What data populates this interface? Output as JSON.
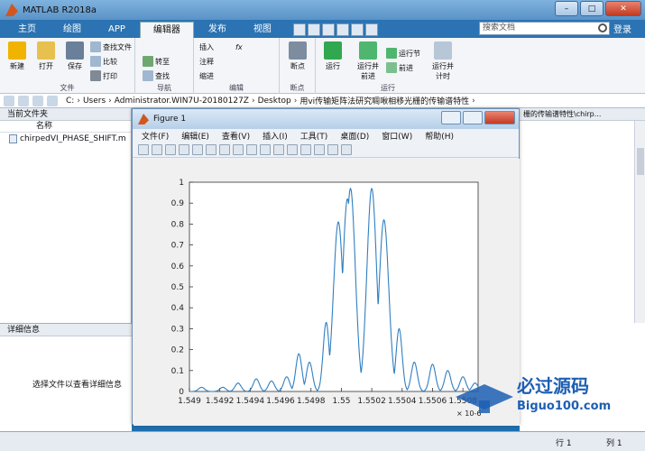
{
  "window": {
    "title": "MATLAB R2018a"
  },
  "tabs": [
    {
      "label": "主页"
    },
    {
      "label": "绘图"
    },
    {
      "label": "APP"
    },
    {
      "label": "编辑器"
    },
    {
      "label": "发布"
    },
    {
      "label": "视图"
    }
  ],
  "search": {
    "placeholder": "搜索文档"
  },
  "login": "登录",
  "ribbon": {
    "new": "新建",
    "open": "打开",
    "save": "保存",
    "find_files": "查找文件",
    "compare": "比较",
    "print": "打印",
    "group_file": "文件",
    "goto": "转至",
    "find": "查找",
    "group_nav": "导航",
    "insert": "插入",
    "comment": "注释",
    "indent": "缩进",
    "fx": "fx",
    "group_edit": "编辑",
    "breakpoints": "断点",
    "group_bp": "断点",
    "run": "运行",
    "run_adv": "运行并\n前进",
    "run_section": "运行节",
    "advance": "前进",
    "run_time": "运行并\n计时",
    "group_run": "运行"
  },
  "path": [
    "C:",
    "Users",
    "Administrator.WIN7U-20180127Z",
    "Desktop",
    "用vi传输矩阵法研究啁啾相移光栅的传输谱特性"
  ],
  "leftpanel": {
    "header": "当前文件夹",
    "column": "名称",
    "file": "chirpedVI_PHASE_SHIFT.m"
  },
  "details": {
    "header": "详细信息",
    "hint": "选择文件以查看详细信息"
  },
  "rightpath": "栅的传输谱特性\\chirp...",
  "status": {
    "row_label": "行",
    "row": "1",
    "col_label": "列",
    "col": "1"
  },
  "figure": {
    "title": "Figure 1",
    "menu": [
      "文件(F)",
      "编辑(E)",
      "查看(V)",
      "插入(I)",
      "工具(T)",
      "桌面(D)",
      "窗口(W)",
      "帮助(H)"
    ]
  },
  "logo": {
    "name": "必过源码",
    "site": "Biguo100.com"
  },
  "chart_data": {
    "type": "line",
    "title": "",
    "xlabel": "",
    "ylabel": "",
    "x_exponent_label": "× 10-6",
    "xlim": [
      1.549,
      1.5509
    ],
    "ylim": [
      0,
      1
    ],
    "xticks": [
      "1.549",
      "1.5492",
      "1.5494",
      "1.5496",
      "1.5498",
      "1.55",
      "1.5502",
      "1.5504",
      "1.5506",
      "1.5508"
    ],
    "yticks": [
      "0",
      "0.1",
      "0.2",
      "0.3",
      "0.4",
      "0.5",
      "0.6",
      "0.7",
      "0.8",
      "0.9",
      "1"
    ],
    "color": "#2f7fc1",
    "series": [
      {
        "peaks": [
          {
            "x": 1.54908,
            "y": 0.02
          },
          {
            "x": 1.54922,
            "y": 0.02
          },
          {
            "x": 1.54932,
            "y": 0.04
          },
          {
            "x": 1.54944,
            "y": 0.06
          },
          {
            "x": 1.54954,
            "y": 0.05
          },
          {
            "x": 1.54964,
            "y": 0.07
          },
          {
            "x": 1.54972,
            "y": 0.18
          },
          {
            "x": 1.54979,
            "y": 0.14
          },
          {
            "x": 1.5499,
            "y": 0.33
          },
          {
            "x": 1.54998,
            "y": 0.81
          },
          {
            "x": 1.55004,
            "y": 0.92
          },
          {
            "x": 1.55006,
            "y": 0.97
          },
          {
            "x": 1.5502,
            "y": 0.97
          },
          {
            "x": 1.55028,
            "y": 0.82
          },
          {
            "x": 1.55038,
            "y": 0.3
          },
          {
            "x": 1.55048,
            "y": 0.14
          },
          {
            "x": 1.5506,
            "y": 0.13
          },
          {
            "x": 1.5507,
            "y": 0.1
          },
          {
            "x": 1.5508,
            "y": 0.07
          },
          {
            "x": 1.55088,
            "y": 0.04
          }
        ]
      }
    ]
  }
}
